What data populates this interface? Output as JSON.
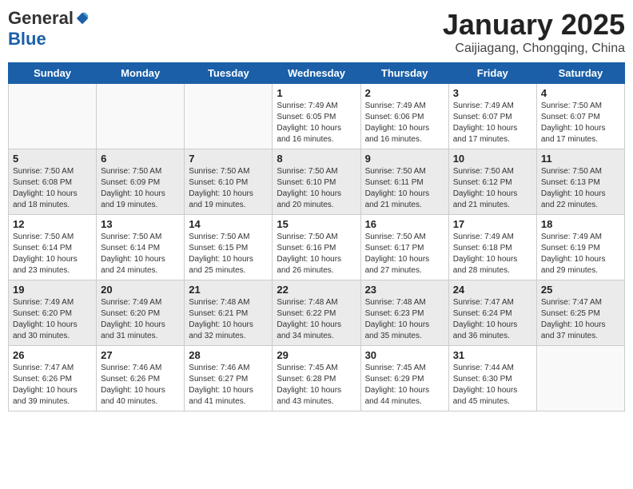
{
  "logo": {
    "general": "General",
    "blue": "Blue"
  },
  "header": {
    "month": "January 2025",
    "location": "Caijiagang, Chongqing, China"
  },
  "weekdays": [
    "Sunday",
    "Monday",
    "Tuesday",
    "Wednesday",
    "Thursday",
    "Friday",
    "Saturday"
  ],
  "weeks": [
    [
      {
        "day": "",
        "info": ""
      },
      {
        "day": "",
        "info": ""
      },
      {
        "day": "",
        "info": ""
      },
      {
        "day": "1",
        "info": "Sunrise: 7:49 AM\nSunset: 6:05 PM\nDaylight: 10 hours and 16 minutes."
      },
      {
        "day": "2",
        "info": "Sunrise: 7:49 AM\nSunset: 6:06 PM\nDaylight: 10 hours and 16 minutes."
      },
      {
        "day": "3",
        "info": "Sunrise: 7:49 AM\nSunset: 6:07 PM\nDaylight: 10 hours and 17 minutes."
      },
      {
        "day": "4",
        "info": "Sunrise: 7:50 AM\nSunset: 6:07 PM\nDaylight: 10 hours and 17 minutes."
      }
    ],
    [
      {
        "day": "5",
        "info": "Sunrise: 7:50 AM\nSunset: 6:08 PM\nDaylight: 10 hours and 18 minutes."
      },
      {
        "day": "6",
        "info": "Sunrise: 7:50 AM\nSunset: 6:09 PM\nDaylight: 10 hours and 19 minutes."
      },
      {
        "day": "7",
        "info": "Sunrise: 7:50 AM\nSunset: 6:10 PM\nDaylight: 10 hours and 19 minutes."
      },
      {
        "day": "8",
        "info": "Sunrise: 7:50 AM\nSunset: 6:10 PM\nDaylight: 10 hours and 20 minutes."
      },
      {
        "day": "9",
        "info": "Sunrise: 7:50 AM\nSunset: 6:11 PM\nDaylight: 10 hours and 21 minutes."
      },
      {
        "day": "10",
        "info": "Sunrise: 7:50 AM\nSunset: 6:12 PM\nDaylight: 10 hours and 21 minutes."
      },
      {
        "day": "11",
        "info": "Sunrise: 7:50 AM\nSunset: 6:13 PM\nDaylight: 10 hours and 22 minutes."
      }
    ],
    [
      {
        "day": "12",
        "info": "Sunrise: 7:50 AM\nSunset: 6:14 PM\nDaylight: 10 hours and 23 minutes."
      },
      {
        "day": "13",
        "info": "Sunrise: 7:50 AM\nSunset: 6:14 PM\nDaylight: 10 hours and 24 minutes."
      },
      {
        "day": "14",
        "info": "Sunrise: 7:50 AM\nSunset: 6:15 PM\nDaylight: 10 hours and 25 minutes."
      },
      {
        "day": "15",
        "info": "Sunrise: 7:50 AM\nSunset: 6:16 PM\nDaylight: 10 hours and 26 minutes."
      },
      {
        "day": "16",
        "info": "Sunrise: 7:50 AM\nSunset: 6:17 PM\nDaylight: 10 hours and 27 minutes."
      },
      {
        "day": "17",
        "info": "Sunrise: 7:49 AM\nSunset: 6:18 PM\nDaylight: 10 hours and 28 minutes."
      },
      {
        "day": "18",
        "info": "Sunrise: 7:49 AM\nSunset: 6:19 PM\nDaylight: 10 hours and 29 minutes."
      }
    ],
    [
      {
        "day": "19",
        "info": "Sunrise: 7:49 AM\nSunset: 6:20 PM\nDaylight: 10 hours and 30 minutes."
      },
      {
        "day": "20",
        "info": "Sunrise: 7:49 AM\nSunset: 6:20 PM\nDaylight: 10 hours and 31 minutes."
      },
      {
        "day": "21",
        "info": "Sunrise: 7:48 AM\nSunset: 6:21 PM\nDaylight: 10 hours and 32 minutes."
      },
      {
        "day": "22",
        "info": "Sunrise: 7:48 AM\nSunset: 6:22 PM\nDaylight: 10 hours and 34 minutes."
      },
      {
        "day": "23",
        "info": "Sunrise: 7:48 AM\nSunset: 6:23 PM\nDaylight: 10 hours and 35 minutes."
      },
      {
        "day": "24",
        "info": "Sunrise: 7:47 AM\nSunset: 6:24 PM\nDaylight: 10 hours and 36 minutes."
      },
      {
        "day": "25",
        "info": "Sunrise: 7:47 AM\nSunset: 6:25 PM\nDaylight: 10 hours and 37 minutes."
      }
    ],
    [
      {
        "day": "26",
        "info": "Sunrise: 7:47 AM\nSunset: 6:26 PM\nDaylight: 10 hours and 39 minutes."
      },
      {
        "day": "27",
        "info": "Sunrise: 7:46 AM\nSunset: 6:26 PM\nDaylight: 10 hours and 40 minutes."
      },
      {
        "day": "28",
        "info": "Sunrise: 7:46 AM\nSunset: 6:27 PM\nDaylight: 10 hours and 41 minutes."
      },
      {
        "day": "29",
        "info": "Sunrise: 7:45 AM\nSunset: 6:28 PM\nDaylight: 10 hours and 43 minutes."
      },
      {
        "day": "30",
        "info": "Sunrise: 7:45 AM\nSunset: 6:29 PM\nDaylight: 10 hours and 44 minutes."
      },
      {
        "day": "31",
        "info": "Sunrise: 7:44 AM\nSunset: 6:30 PM\nDaylight: 10 hours and 45 minutes."
      },
      {
        "day": "",
        "info": ""
      }
    ]
  ]
}
